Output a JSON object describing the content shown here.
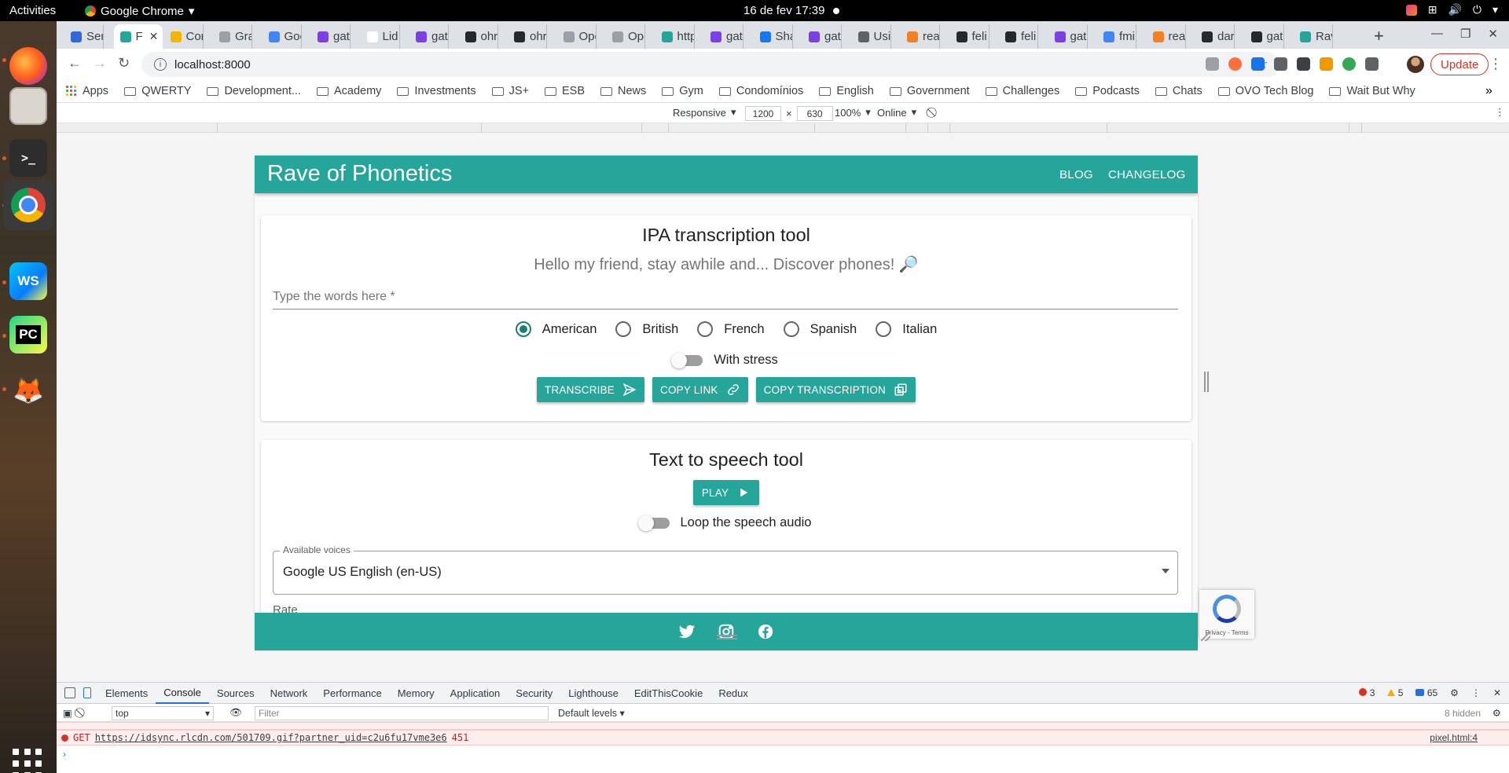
{
  "system": {
    "activities": "Activities",
    "app_name": "Google Chrome",
    "clock": "16 de fev  17:39"
  },
  "dock": {
    "items": [
      "firefox-icon",
      "files-icon",
      "terminal-icon",
      "chrome-icon",
      "webstorm-icon",
      "pycharm-icon",
      "gimp-icon",
      "show-apps-icon"
    ],
    "terminal_label": ">_",
    "webstorm_label": "WS",
    "pycharm_label": "PC"
  },
  "tabs": [
    {
      "label": "Ser",
      "color": "#3367d6"
    },
    {
      "label": "F",
      "color": "#26a69a",
      "active": true
    },
    {
      "label": "Cor",
      "color": "#f4b400"
    },
    {
      "label": "Gra",
      "color": "#9aa0a6"
    },
    {
      "label": "Goo",
      "color": "#4285f4"
    },
    {
      "label": "gat",
      "color": "#7b3fe4"
    },
    {
      "label": "Lid",
      "color": "#ffffff"
    },
    {
      "label": "gat",
      "color": "#7b3fe4"
    },
    {
      "label": "ohr",
      "color": "#24292e"
    },
    {
      "label": "ohr",
      "color": "#24292e"
    },
    {
      "label": "Ope",
      "color": "#9aa0a6"
    },
    {
      "label": "Ope",
      "color": "#9aa0a6"
    },
    {
      "label": "http",
      "color": "#26a69a"
    },
    {
      "label": "gat",
      "color": "#7b3fe4"
    },
    {
      "label": "Sha",
      "color": "#1877f2"
    },
    {
      "label": "gat",
      "color": "#7b3fe4"
    },
    {
      "label": "Usi",
      "color": "#5f6368"
    },
    {
      "label": "rea",
      "color": "#f48024"
    },
    {
      "label": "feli",
      "color": "#24292e"
    },
    {
      "label": "feli",
      "color": "#24292e"
    },
    {
      "label": "gat",
      "color": "#7b3fe4"
    },
    {
      "label": "fmi",
      "color": "#4285f4"
    },
    {
      "label": "rea",
      "color": "#f48024"
    },
    {
      "label": "dar",
      "color": "#24292e"
    },
    {
      "label": "gat",
      "color": "#24292e"
    },
    {
      "label": "Rav",
      "color": "#26a69a"
    }
  ],
  "address": {
    "url": "localhost:8000"
  },
  "browser": {
    "update_label": "Update"
  },
  "bookmarks": {
    "apps": "Apps",
    "items": [
      "QWERTY",
      "Development...",
      "Academy",
      "Investments",
      "JS+",
      "ESB",
      "News",
      "Gym",
      "Condomínios",
      "English",
      "Government",
      "Challenges",
      "Podcasts",
      "Chats",
      "OVO Tech Blog",
      "Wait But Why"
    ]
  },
  "device_toolbar": {
    "mode": "Responsive",
    "width": "1200",
    "height": "630",
    "zoom": "100%",
    "network": "Online"
  },
  "site": {
    "brand": "Rave of Phonetics",
    "nav": [
      "BLOG",
      "CHANGELOG"
    ],
    "ipa": {
      "title": "IPA transcription tool",
      "subtitle": "Hello my friend, stay awhile and... Discover phones! 🔎",
      "placeholder": "Type the words here *",
      "languages": [
        "American",
        "British",
        "French",
        "Spanish",
        "Italian"
      ],
      "selected_language": "American",
      "stress_label": "With stress",
      "buttons": [
        "TRANSCRIBE",
        "COPY LINK",
        "COPY TRANSCRIPTION"
      ]
    },
    "tts": {
      "title": "Text to speech tool",
      "play_label": "PLAY",
      "loop_label": "Loop the speech audio",
      "voices_label": "Available voices",
      "voice_value": "Google US English (en-US)",
      "rate_label": "Rate"
    },
    "recaptcha_terms": "Privacy - Terms"
  },
  "devtools": {
    "tabs": [
      "Elements",
      "Console",
      "Sources",
      "Network",
      "Performance",
      "Memory",
      "Application",
      "Security",
      "Lighthouse",
      "EditThisCookie",
      "Redux"
    ],
    "active_tab": "Console",
    "errors": "3",
    "warnings": "5",
    "messages": "65",
    "context": "top",
    "filter_placeholder": "Filter",
    "levels": "Default levels",
    "hidden": "8 hidden",
    "log": {
      "method": "GET",
      "url": "https://idsync.rlcdn.com/501709.gif?partner_uid=c2u6fu17vme3e6",
      "status": "451",
      "source": "pixel.html:4"
    }
  }
}
